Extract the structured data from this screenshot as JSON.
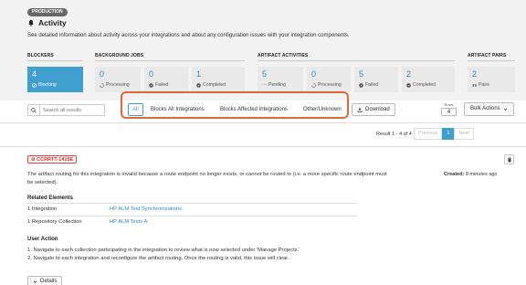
{
  "header": {
    "badge": "PRODUCTION",
    "title": "Activity",
    "subtitle": "See detailed information about activity across your integrations and about any configuration issues with your integration components."
  },
  "groups": {
    "blockers": "BLOCKERS",
    "background_jobs": "BACKGROUND JOBS",
    "artifact_activities": "ARTIFACT ACTIVITIES",
    "artifact_pairs": "ARTIFACT PAIRS"
  },
  "tiles": {
    "blocking": {
      "value": "4",
      "label": "Blocking",
      "icon": "circle-slash-icon"
    },
    "jobs_processing": {
      "value": "0",
      "label": "Processing",
      "icon": "spinner-icon"
    },
    "jobs_failed": {
      "value": "0",
      "label": "Failed",
      "icon": "x-circle-icon"
    },
    "jobs_completed": {
      "value": "1",
      "label": "Completed",
      "icon": "check-circle-icon"
    },
    "art_pending": {
      "value": "5",
      "label": "Pending",
      "icon": "ellipsis-icon"
    },
    "art_processing": {
      "value": "0",
      "label": "Processing",
      "icon": "spinner-icon"
    },
    "art_failed": {
      "value": "5",
      "label": "Failed",
      "icon": "x-circle-icon"
    },
    "art_completed": {
      "value": "2",
      "label": "Completed",
      "icon": "check-circle-icon"
    },
    "pairs": {
      "value": "2",
      "label": "Pairs",
      "icon": "pairs-icon"
    }
  },
  "toolbar": {
    "search_placeholder": "Search all results",
    "filters": [
      "All",
      "Blocks All Integrations",
      "Blocks Affected Integrations",
      "Other/Unknown"
    ],
    "download_label": "Download",
    "rows_label": "Rows",
    "rows_value": "4",
    "bulk_label": "Bulk Actions"
  },
  "pagination": {
    "summary": "Result 1 - 4 of 4",
    "previous": "Previous",
    "current": "1",
    "next": "Next"
  },
  "issue": {
    "id": "CCRRTT-1415E",
    "description": "The artifact routing for this integration is invalid because a route endpoint no longer exists, or cannot be routed to (i.e. a more specific route endpoint must be selected).",
    "created_label": "Created:",
    "created_value": "8 minutes ago",
    "related_title": "Related Elements",
    "related": [
      {
        "type": "1 Integration",
        "name": "HP ALM Test Synchronizations"
      },
      {
        "type": "1 Repository Collection",
        "name": "HP ALM Tests A"
      }
    ],
    "user_action_title": "User Action",
    "actions": [
      "1. Navigate to each collection participating in the integration to review what is now selected under 'Manage Projects.'",
      "2. Navigate to each integration and reconfigure the artifact routing. Once the routing is valid, this issue will clear."
    ],
    "details_label": "Details"
  },
  "colors": {
    "accent": "#3f9fce",
    "highlight_border": "#e0673a",
    "error": "#cc3333"
  }
}
